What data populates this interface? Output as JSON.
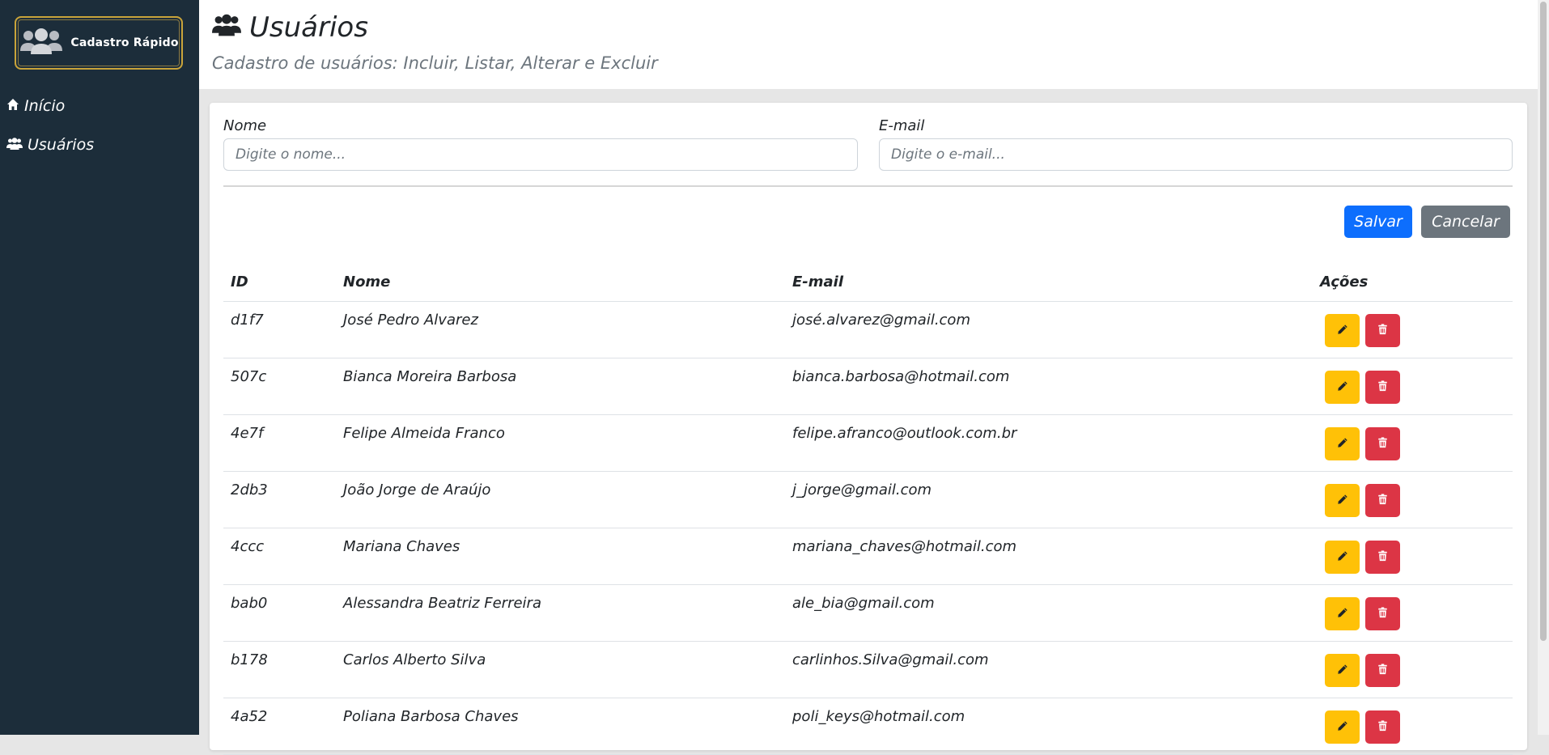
{
  "sidebar": {
    "logo_text": "Cadastro Rápido",
    "items": [
      {
        "label": "Início",
        "icon": "home-icon"
      },
      {
        "label": "Usuários",
        "icon": "users-icon"
      }
    ]
  },
  "header": {
    "title": "Usuários",
    "subtitle": "Cadastro de usuários: Incluir, Listar, Alterar e Excluir"
  },
  "form": {
    "name_label": "Nome",
    "name_placeholder": "Digite o nome...",
    "name_value": "",
    "email_label": "E-mail",
    "email_placeholder": "Digite o e-mail...",
    "email_value": "",
    "save_label": "Salvar",
    "cancel_label": "Cancelar"
  },
  "table": {
    "headers": {
      "id": "ID",
      "name": "Nome",
      "email": "E-mail",
      "actions": "Ações"
    },
    "rows": [
      {
        "id": "d1f7",
        "name": "José Pedro Alvarez",
        "email": "josé.alvarez@gmail.com"
      },
      {
        "id": "507c",
        "name": "Bianca Moreira Barbosa",
        "email": "bianca.barbosa@hotmail.com"
      },
      {
        "id": "4e7f",
        "name": "Felipe Almeida Franco",
        "email": "felipe.afranco@outlook.com.br"
      },
      {
        "id": "2db3",
        "name": "João Jorge de Araújo",
        "email": "j_jorge@gmail.com"
      },
      {
        "id": "4ccc",
        "name": "Mariana Chaves",
        "email": "mariana_chaves@hotmail.com"
      },
      {
        "id": "bab0",
        "name": "Alessandra Beatriz Ferreira",
        "email": "ale_bia@gmail.com"
      },
      {
        "id": "b178",
        "name": "Carlos Alberto Silva",
        "email": "carlinhos.Silva@gmail.com"
      },
      {
        "id": "4a52",
        "name": "Poliana Barbosa Chaves",
        "email": "poli_keys@hotmail.com"
      }
    ]
  },
  "colors": {
    "sidebar_bg": "#1c2d3a",
    "logo_border": "#c9a43a",
    "primary": "#0d6efd",
    "secondary": "#6c757d",
    "warning": "#ffc107",
    "danger": "#dc3545"
  }
}
